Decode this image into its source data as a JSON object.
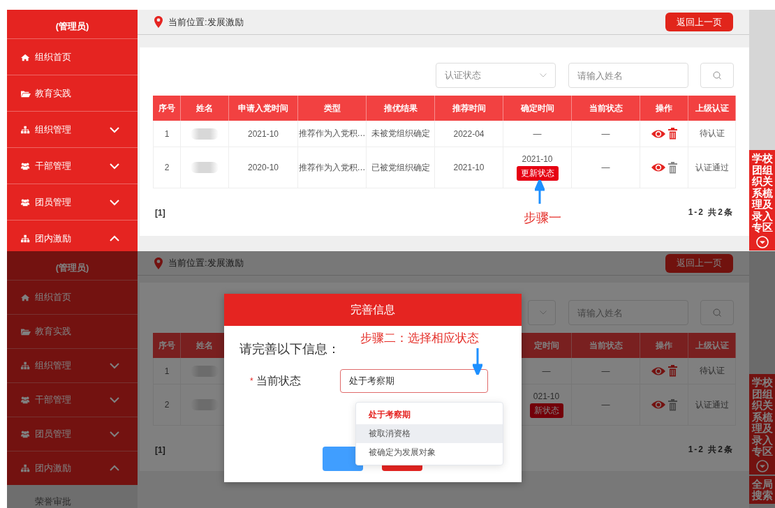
{
  "screens": [
    {
      "dimmed": false,
      "sidebar": {
        "role": "(管理员)",
        "items": [
          {
            "label": "组织首页",
            "kind": "link"
          },
          {
            "label": "教育实践",
            "kind": "link"
          },
          {
            "label": "组织管理",
            "kind": "menu",
            "expanded": false
          },
          {
            "label": "干部管理",
            "kind": "menu",
            "expanded": false
          },
          {
            "label": "团员管理",
            "kind": "menu",
            "expanded": false
          },
          {
            "label": "团内激励",
            "kind": "menu",
            "expanded": true
          }
        ]
      },
      "breadcrumb": "当前位置:发展激励",
      "back_button": "返回上一页",
      "filters": {
        "status_select": {
          "placeholder": "认证状态"
        },
        "name_input": {
          "placeholder": "请输入姓名"
        }
      },
      "table": {
        "columns": [
          "序号",
          "姓名",
          "申请入党时间",
          "类型",
          "推优结果",
          "推荐时间",
          "确定时间",
          "当前状态",
          "操作",
          "上级认证"
        ],
        "rows": [
          {
            "cells": [
              {
                "kind": "text",
                "text": "1"
              },
              {
                "kind": "blurred"
              },
              {
                "kind": "text",
                "text": "2021-10"
              },
              {
                "kind": "text",
                "text": "推荐作为入党积…"
              },
              {
                "kind": "text",
                "text": "未被党组织确定"
              },
              {
                "kind": "text",
                "text": "2022-04"
              },
              {
                "kind": "text",
                "text": "—"
              },
              {
                "kind": "text",
                "text": "—"
              },
              {
                "kind": "actions",
                "deletable": true
              },
              {
                "kind": "text",
                "text": "待认证"
              }
            ]
          },
          {
            "cells": [
              {
                "kind": "text",
                "text": "2"
              },
              {
                "kind": "blurred"
              },
              {
                "kind": "text",
                "text": "2020-10"
              },
              {
                "kind": "text",
                "text": "推荐作为入党积…"
              },
              {
                "kind": "text",
                "text": "已被党组织确定"
              },
              {
                "kind": "text",
                "text": "2021-10"
              },
              {
                "kind": "date_button",
                "text": "2021-10",
                "button": "更新状态"
              },
              {
                "kind": "text",
                "text": "—"
              },
              {
                "kind": "actions",
                "deletable": false
              },
              {
                "kind": "text",
                "text": "认证通过"
              }
            ]
          }
        ]
      },
      "pagination": {
        "pages": "[1]",
        "summary": "1-2 共2条"
      },
      "side_tags": [
        {
          "label": "学校团组织关系梳理及录入专区"
        }
      ],
      "annotation": {
        "text": "步骤一"
      }
    },
    {
      "dimmed": true,
      "sidebar": {
        "role": "(管理员)",
        "items": [
          {
            "label": "组织首页",
            "kind": "link"
          },
          {
            "label": "教育实践",
            "kind": "link"
          },
          {
            "label": "组织管理",
            "kind": "menu",
            "expanded": false
          },
          {
            "label": "干部管理",
            "kind": "menu",
            "expanded": false
          },
          {
            "label": "团员管理",
            "kind": "menu",
            "expanded": false
          },
          {
            "label": "团内激励",
            "kind": "menu",
            "expanded": true,
            "children": [
              {
                "label": "荣誉审批"
              }
            ]
          }
        ]
      },
      "breadcrumb": "当前位置:发展激励",
      "back_button": "返回上一页",
      "filters": {
        "name_input": {
          "placeholder": "请输入姓名"
        }
      },
      "table": {
        "left_columns": [
          "序号",
          "姓名"
        ],
        "right_columns": [
          "定时间",
          "当前状态",
          "操作",
          "上级认证"
        ],
        "rows": [
          {
            "left_cells": [
              {
                "kind": "text",
                "text": "1"
              },
              {
                "kind": "blurred"
              }
            ],
            "right_cells": [
              {
                "kind": "text",
                "text": "—"
              },
              {
                "kind": "text",
                "text": "—"
              },
              {
                "kind": "actions",
                "deletable": true
              },
              {
                "kind": "text",
                "text": "待认证"
              }
            ]
          },
          {
            "left_cells": [
              {
                "kind": "text",
                "text": "2"
              },
              {
                "kind": "blurred"
              }
            ],
            "right_cells": [
              {
                "kind": "date_button",
                "text": "021-10",
                "button": "新状态"
              },
              {
                "kind": "text",
                "text": "—"
              },
              {
                "kind": "actions",
                "deletable": false
              },
              {
                "kind": "text",
                "text": "认证通过"
              }
            ]
          }
        ]
      },
      "pagination": {
        "pages": "[1]",
        "summary": "1-2 共2条"
      },
      "side_tags": [
        {
          "label": "学校团组织关系梳理及录入专区"
        },
        {
          "label": "全局搜索"
        }
      ],
      "dialog": {
        "title": "完善信息",
        "prompt": "请完善以下信息：",
        "annotation": {
          "text": "步骤二：选择相应状态"
        },
        "field": {
          "label": "当前状态",
          "required_mark": "*",
          "value": "处于考察期"
        },
        "options": [
          {
            "label": "处于考察期",
            "selected": true,
            "hovered": false
          },
          {
            "label": "被取消资格",
            "selected": false,
            "hovered": true
          },
          {
            "label": "被确定为发展对象",
            "selected": false,
            "hovered": false
          }
        ]
      }
    }
  ]
}
